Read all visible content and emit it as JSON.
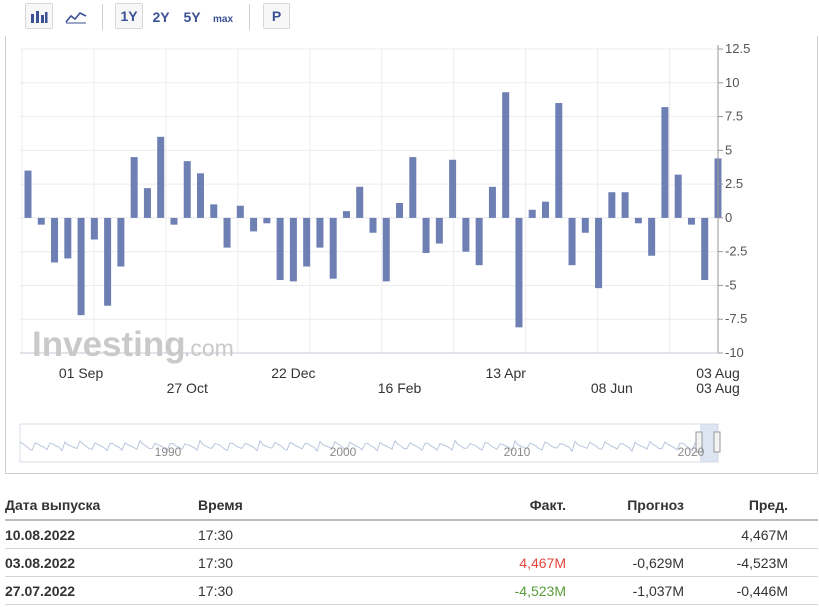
{
  "toolbar": {
    "bar_chart_icon": "bar-chart-icon",
    "line_chart_icon": "line-chart-icon",
    "range_1y": "1Y",
    "range_2y": "2Y",
    "range_5y": "5Y",
    "range_max": "max",
    "print_label": "P"
  },
  "watermark": {
    "brand": "Investing",
    "suffix": ".com"
  },
  "navigator": {
    "years": [
      "1990",
      "2000",
      "2010",
      "2020"
    ]
  },
  "chart_data": {
    "type": "bar",
    "title": "",
    "xlabel": "",
    "ylabel": "",
    "ylim": [
      -10,
      12.5
    ],
    "yticks": [
      "12.5",
      "10",
      "7.5",
      "5",
      "2.5",
      "0",
      "-2.5",
      "-5",
      "-7.5",
      "-10"
    ],
    "xtick_labels": [
      {
        "label": "01 Sep",
        "index": 4,
        "row": 1
      },
      {
        "label": "27 Oct",
        "index": 12,
        "row": 2
      },
      {
        "label": "22 Dec",
        "index": 20,
        "row": 1
      },
      {
        "label": "16 Feb",
        "index": 28,
        "row": 2
      },
      {
        "label": "13 Apr",
        "index": 36,
        "row": 1
      },
      {
        "label": "08 Jun",
        "index": 44,
        "row": 2
      },
      {
        "label": "03 Aug",
        "index": 52,
        "row": 1
      },
      {
        "label": "03 Aug",
        "index": 52,
        "row": 2
      }
    ],
    "values": [
      3.5,
      -0.5,
      -3.3,
      -3.0,
      -7.2,
      -1.6,
      -6.5,
      -3.6,
      4.5,
      2.2,
      6.0,
      -0.5,
      4.2,
      3.3,
      1.0,
      -2.2,
      0.9,
      -1.0,
      -0.4,
      -4.6,
      -4.7,
      -3.6,
      -2.2,
      -4.5,
      0.5,
      2.3,
      -1.1,
      -4.7,
      1.1,
      4.5,
      -2.6,
      -1.9,
      4.3,
      -2.5,
      -3.5,
      2.3,
      9.3,
      -8.1,
      0.6,
      1.2,
      8.5,
      -3.5,
      -1.1,
      -5.2,
      1.9,
      1.9,
      -0.4,
      -2.8,
      8.2,
      3.2,
      -0.5,
      -4.6,
      4.4
    ],
    "bar_color": "#6d7fb3",
    "grid": true
  },
  "table": {
    "headers": {
      "date": "Дата выпуска",
      "time": "Время",
      "actual": "Факт.",
      "forecast": "Прогноз",
      "previous": "Пред."
    },
    "rows": [
      {
        "date": "10.08.2022",
        "time": "17:30",
        "actual": "",
        "forecast": "",
        "previous": "4,467M"
      },
      {
        "date": "03.08.2022",
        "time": "17:30",
        "actual": "4,467M",
        "forecast": "-0,629M",
        "previous": "-4,523M"
      },
      {
        "date": "27.07.2022",
        "time": "17:30",
        "actual": "-4,523M",
        "forecast": "-1,037M",
        "previous": "-0,446M"
      }
    ],
    "colors": {
      "positive": "#e8453c",
      "negative": "#5b9d3a"
    }
  }
}
